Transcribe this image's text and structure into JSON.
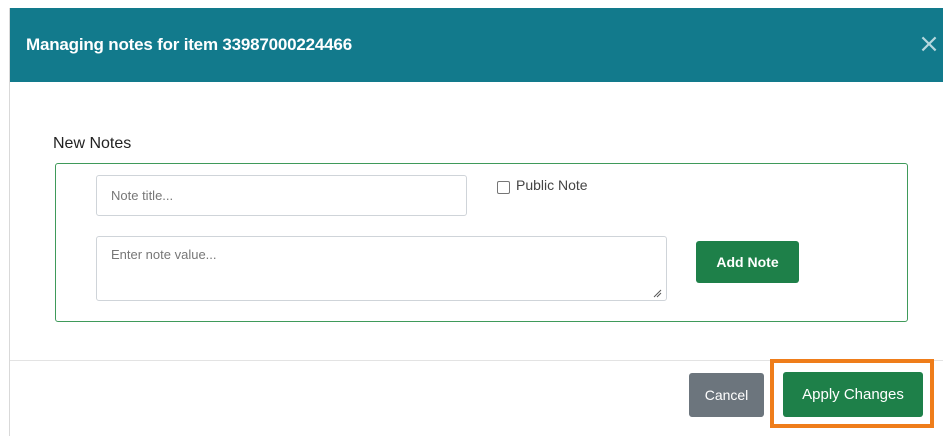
{
  "modal": {
    "title": "Managing notes for item 33987000224466",
    "close_glyph": "×"
  },
  "new_notes": {
    "section_label": "New Notes",
    "title_placeholder": "Note title...",
    "title_value": "",
    "public_note_label": "Public Note",
    "public_note_checked": false,
    "value_placeholder": "Enter note value...",
    "value_value": "",
    "add_note_label": "Add Note"
  },
  "footer": {
    "cancel_label": "Cancel",
    "apply_label": "Apply Changes"
  },
  "colors": {
    "header": "#127a8c",
    "primary_green": "#1e8049",
    "box_border": "#3f9a5a",
    "cancel_gray": "#6c757d",
    "highlight_orange": "#ef7d1a"
  },
  "icons": {
    "close": "close-icon",
    "checkbox": "checkbox-icon",
    "resize": "resize-grip-icon"
  }
}
